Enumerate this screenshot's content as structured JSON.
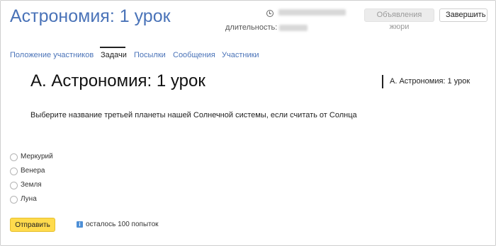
{
  "header": {
    "contest_title": "Астрономия: 1 урок",
    "duration_label": "длительность:",
    "jury_button": "Объявления жюри",
    "finish_button": "Завершить"
  },
  "tabs": [
    {
      "label": "Положение участников",
      "active": false
    },
    {
      "label": "Задачи",
      "active": true
    },
    {
      "label": "Посылки",
      "active": false
    },
    {
      "label": "Сообщения",
      "active": false
    },
    {
      "label": "Участники",
      "active": false
    }
  ],
  "problem": {
    "title": "A. Астрономия: 1 урок",
    "sidebar_link": "A. Астрономия: 1 урок",
    "statement": "Выберите название третьей планеты нашей Солнечной системы, если считать от Солнца",
    "options": [
      "Меркурий",
      "Венера",
      "Земля",
      "Луна"
    ],
    "submit_label": "Отправить",
    "attempts_text": "осталось 100 попыток"
  },
  "icons": {
    "clock": "clock-icon",
    "info": "info-icon"
  },
  "colors": {
    "link": "#4a73b8",
    "submit": "#ffdb4d",
    "info": "#4d8fd6"
  }
}
